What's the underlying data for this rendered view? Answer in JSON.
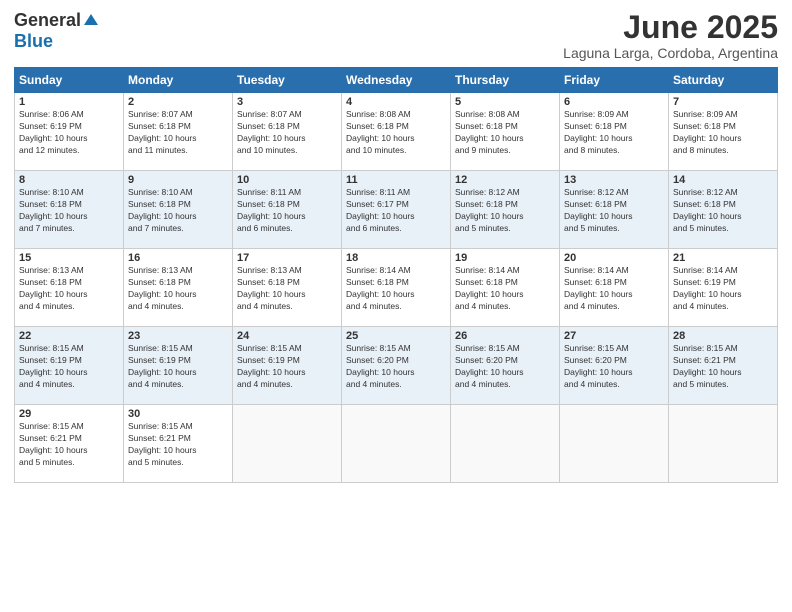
{
  "header": {
    "logo_general": "General",
    "logo_blue": "Blue",
    "month_title": "June 2025",
    "location": "Laguna Larga, Cordoba, Argentina"
  },
  "days_of_week": [
    "Sunday",
    "Monday",
    "Tuesday",
    "Wednesday",
    "Thursday",
    "Friday",
    "Saturday"
  ],
  "weeks": [
    [
      {
        "day": "1",
        "sunrise": "8:06 AM",
        "sunset": "6:19 PM",
        "daylight": "10 hours and 12 minutes."
      },
      {
        "day": "2",
        "sunrise": "8:07 AM",
        "sunset": "6:18 PM",
        "daylight": "10 hours and 11 minutes."
      },
      {
        "day": "3",
        "sunrise": "8:07 AM",
        "sunset": "6:18 PM",
        "daylight": "10 hours and 10 minutes."
      },
      {
        "day": "4",
        "sunrise": "8:08 AM",
        "sunset": "6:18 PM",
        "daylight": "10 hours and 10 minutes."
      },
      {
        "day": "5",
        "sunrise": "8:08 AM",
        "sunset": "6:18 PM",
        "daylight": "10 hours and 9 minutes."
      },
      {
        "day": "6",
        "sunrise": "8:09 AM",
        "sunset": "6:18 PM",
        "daylight": "10 hours and 8 minutes."
      },
      {
        "day": "7",
        "sunrise": "8:09 AM",
        "sunset": "6:18 PM",
        "daylight": "10 hours and 8 minutes."
      }
    ],
    [
      {
        "day": "8",
        "sunrise": "8:10 AM",
        "sunset": "6:18 PM",
        "daylight": "10 hours and 7 minutes."
      },
      {
        "day": "9",
        "sunrise": "8:10 AM",
        "sunset": "6:18 PM",
        "daylight": "10 hours and 7 minutes."
      },
      {
        "day": "10",
        "sunrise": "8:11 AM",
        "sunset": "6:18 PM",
        "daylight": "10 hours and 6 minutes."
      },
      {
        "day": "11",
        "sunrise": "8:11 AM",
        "sunset": "6:17 PM",
        "daylight": "10 hours and 6 minutes."
      },
      {
        "day": "12",
        "sunrise": "8:12 AM",
        "sunset": "6:18 PM",
        "daylight": "10 hours and 5 minutes."
      },
      {
        "day": "13",
        "sunrise": "8:12 AM",
        "sunset": "6:18 PM",
        "daylight": "10 hours and 5 minutes."
      },
      {
        "day": "14",
        "sunrise": "8:12 AM",
        "sunset": "6:18 PM",
        "daylight": "10 hours and 5 minutes."
      }
    ],
    [
      {
        "day": "15",
        "sunrise": "8:13 AM",
        "sunset": "6:18 PM",
        "daylight": "10 hours and 4 minutes."
      },
      {
        "day": "16",
        "sunrise": "8:13 AM",
        "sunset": "6:18 PM",
        "daylight": "10 hours and 4 minutes."
      },
      {
        "day": "17",
        "sunrise": "8:13 AM",
        "sunset": "6:18 PM",
        "daylight": "10 hours and 4 minutes."
      },
      {
        "day": "18",
        "sunrise": "8:14 AM",
        "sunset": "6:18 PM",
        "daylight": "10 hours and 4 minutes."
      },
      {
        "day": "19",
        "sunrise": "8:14 AM",
        "sunset": "6:18 PM",
        "daylight": "10 hours and 4 minutes."
      },
      {
        "day": "20",
        "sunrise": "8:14 AM",
        "sunset": "6:18 PM",
        "daylight": "10 hours and 4 minutes."
      },
      {
        "day": "21",
        "sunrise": "8:14 AM",
        "sunset": "6:19 PM",
        "daylight": "10 hours and 4 minutes."
      }
    ],
    [
      {
        "day": "22",
        "sunrise": "8:15 AM",
        "sunset": "6:19 PM",
        "daylight": "10 hours and 4 minutes."
      },
      {
        "day": "23",
        "sunrise": "8:15 AM",
        "sunset": "6:19 PM",
        "daylight": "10 hours and 4 minutes."
      },
      {
        "day": "24",
        "sunrise": "8:15 AM",
        "sunset": "6:19 PM",
        "daylight": "10 hours and 4 minutes."
      },
      {
        "day": "25",
        "sunrise": "8:15 AM",
        "sunset": "6:20 PM",
        "daylight": "10 hours and 4 minutes."
      },
      {
        "day": "26",
        "sunrise": "8:15 AM",
        "sunset": "6:20 PM",
        "daylight": "10 hours and 4 minutes."
      },
      {
        "day": "27",
        "sunrise": "8:15 AM",
        "sunset": "6:20 PM",
        "daylight": "10 hours and 4 minutes."
      },
      {
        "day": "28",
        "sunrise": "8:15 AM",
        "sunset": "6:21 PM",
        "daylight": "10 hours and 5 minutes."
      }
    ],
    [
      {
        "day": "29",
        "sunrise": "8:15 AM",
        "sunset": "6:21 PM",
        "daylight": "10 hours and 5 minutes."
      },
      {
        "day": "30",
        "sunrise": "8:15 AM",
        "sunset": "6:21 PM",
        "daylight": "10 hours and 5 minutes."
      },
      {
        "day": "",
        "sunrise": "",
        "sunset": "",
        "daylight": ""
      },
      {
        "day": "",
        "sunrise": "",
        "sunset": "",
        "daylight": ""
      },
      {
        "day": "",
        "sunrise": "",
        "sunset": "",
        "daylight": ""
      },
      {
        "day": "",
        "sunrise": "",
        "sunset": "",
        "daylight": ""
      },
      {
        "day": "",
        "sunrise": "",
        "sunset": "",
        "daylight": ""
      }
    ]
  ],
  "labels": {
    "sunrise": "Sunrise:",
    "sunset": "Sunset:",
    "daylight": "Daylight:"
  }
}
